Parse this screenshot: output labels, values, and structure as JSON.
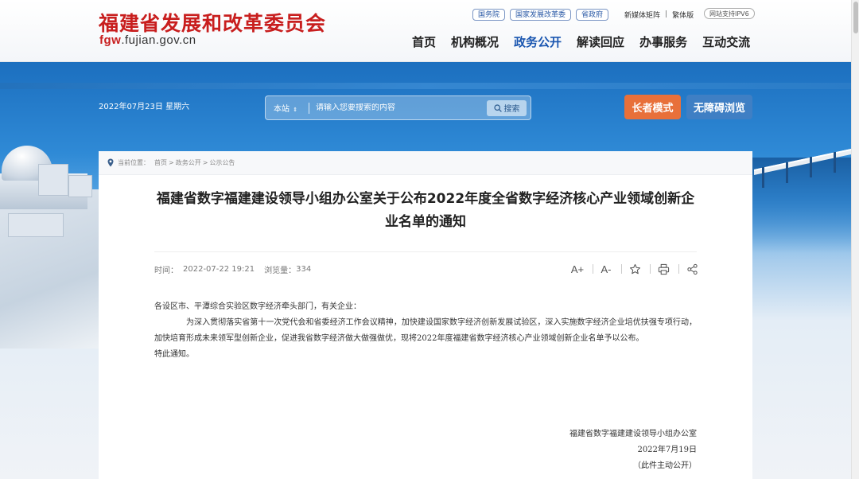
{
  "header": {
    "site_title": "福建省发展和改革委员会",
    "domain_prefix": "fgw",
    "domain_suffix": ".fujian.gov.cn",
    "top_links": [
      "国务院",
      "国家发展改革委",
      "省政府"
    ],
    "new_media": "新媒体矩阵",
    "separator": "|",
    "traditional": "繁体版",
    "ipv6": "网站支持IPV6",
    "nav": [
      "首页",
      "机构概况",
      "政务公开",
      "解读回应",
      "办事服务",
      "互动交流"
    ],
    "active_nav": "政务公开"
  },
  "banner": {
    "date": "2022年07月23日 星期六",
    "search_scope": "本站",
    "search_placeholder": "请输入您要搜索的内容",
    "search_button": "搜索",
    "elder_mode": "长者模式",
    "accessible": "无障碍浏览"
  },
  "breadcrumb": {
    "label": "当前位置：",
    "items": [
      "首页",
      "政务公开",
      "公示公告"
    ],
    "sep": ">"
  },
  "article": {
    "title": "福建省数字福建建设领导小组办公室关于公布2022年度全省数字经济核心产业领域创新企业名单的通知",
    "time_label": "时间：",
    "time": "2022-07-22 19:21",
    "views_label": "浏览量：",
    "views": "334",
    "tools": {
      "font_up": "A+",
      "font_down": "A-"
    },
    "salutation": "各设区市、平潭综合实验区数字经济牵头部门，有关企业：",
    "paragraph": "为深入贯彻落实省第十一次党代会和省委经济工作会议精神，加快建设国家数字经济创新发展试验区，深入实施数字经济企业培优扶强专项行动，加快培育形成未来领军型创新企业，促进我省数字经济做大做强做优，现将2022年度福建省数字经济核心产业领域创新企业名单予以公布。",
    "closing": "特此通知。",
    "signature_org": "福建省数字福建建设领导小组办公室",
    "signature_date": "2022年7月19日",
    "signature_note": "（此件主动公开）"
  },
  "colors": {
    "brand_red": "#c81e1e",
    "nav_active": "#1a56b0",
    "elder_button": "#e8703a",
    "access_button": "#3f7fc4"
  }
}
